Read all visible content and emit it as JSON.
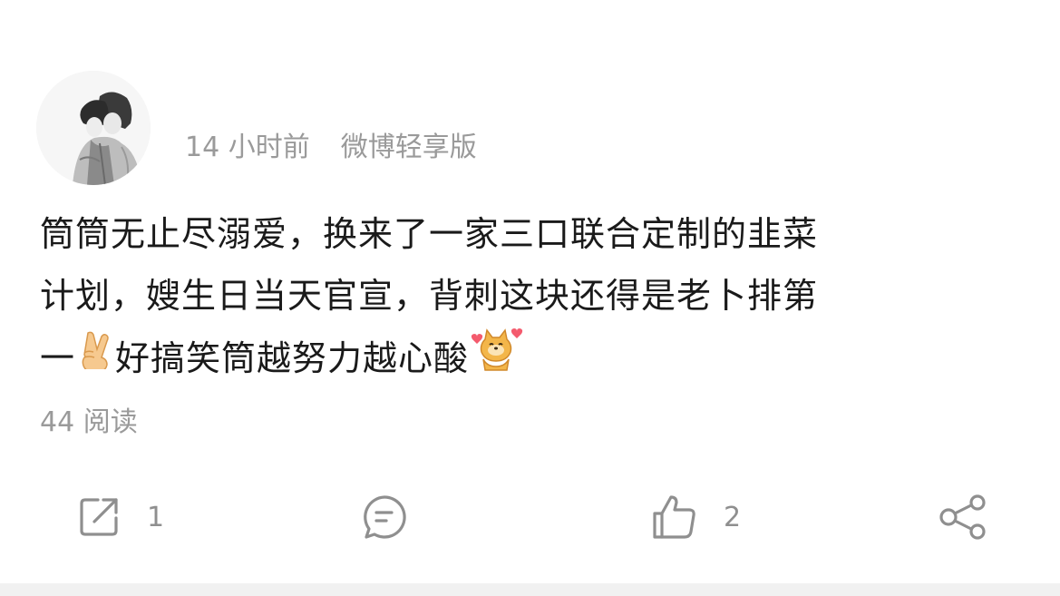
{
  "post": {
    "time": "14 小时前",
    "source": "微博轻享版",
    "content_lines": [
      "筒筒无止尽溺爱，换来了一家三口联合定制的韭菜",
      "计划，嫂生日当天官宣，背刺这块还得是老卜排第"
    ],
    "last_line_before_emoji": "一",
    "last_line_middle": "好搞笑筒越努力越心酸",
    "emojis": [
      "victory-hand-emoji",
      "dog-hearts-emoji"
    ],
    "reads": "44 阅读"
  },
  "actions": {
    "repost_count": "1",
    "like_count": "2",
    "icons": [
      "repost-icon",
      "comment-icon",
      "like-icon",
      "share-icon"
    ]
  },
  "colors": {
    "meta_text": "#9a9a9a",
    "body_text": "#1a1a1a",
    "icon": "#8f8f8f"
  }
}
